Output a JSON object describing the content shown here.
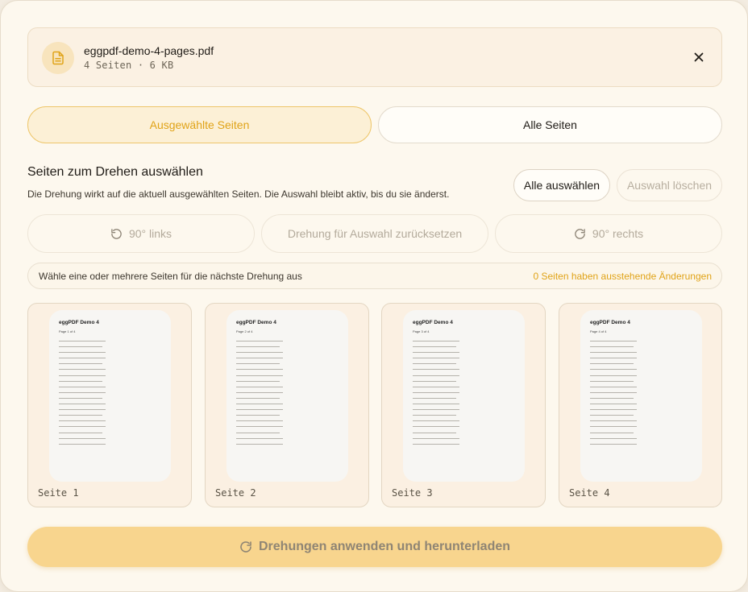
{
  "file": {
    "name": "eggpdf-demo-4-pages.pdf",
    "meta": "4 Seiten · 6 KB",
    "icon": "document-icon"
  },
  "mode_tabs": [
    {
      "label": "Ausgewählte Seiten",
      "active": true
    },
    {
      "label": "Alle Seiten",
      "active": false
    }
  ],
  "selection": {
    "title": "Seiten zum Drehen auswählen",
    "description": "Die Drehung wirkt auf die aktuell ausgewählten Seiten. Die Auswahl bleibt aktiv, bis du sie änderst.",
    "select_all_label": "Alle auswählen",
    "clear_label": "Auswahl löschen"
  },
  "rotation": {
    "left_label": "90° links",
    "reset_label": "Drehung für Auswahl zurücksetzen",
    "right_label": "90° rechts"
  },
  "status": {
    "hint": "Wähle eine oder mehrere Seiten für die nächste Drehung aus",
    "pending": "0 Seiten haben ausstehende Änderungen"
  },
  "pages": [
    {
      "label": "Seite 1",
      "thumb_title": "eggPDF Demo 4",
      "thumb_sub": "Page 1 of 4"
    },
    {
      "label": "Seite 2",
      "thumb_title": "eggPDF Demo 4",
      "thumb_sub": "Page 2 of 4"
    },
    {
      "label": "Seite 3",
      "thumb_title": "eggPDF Demo 4",
      "thumb_sub": "Page 3 of 4"
    },
    {
      "label": "Seite 4",
      "thumb_title": "eggPDF Demo 4",
      "thumb_sub": "Page 4 of 4"
    }
  ],
  "apply": {
    "label": "Drehungen anwenden und herunterladen",
    "icon": "rotate-cw-icon"
  },
  "colors": {
    "accent": "#e0a318",
    "apply_bg": "#f8d58e",
    "panel_bg": "#fdf8ee"
  }
}
